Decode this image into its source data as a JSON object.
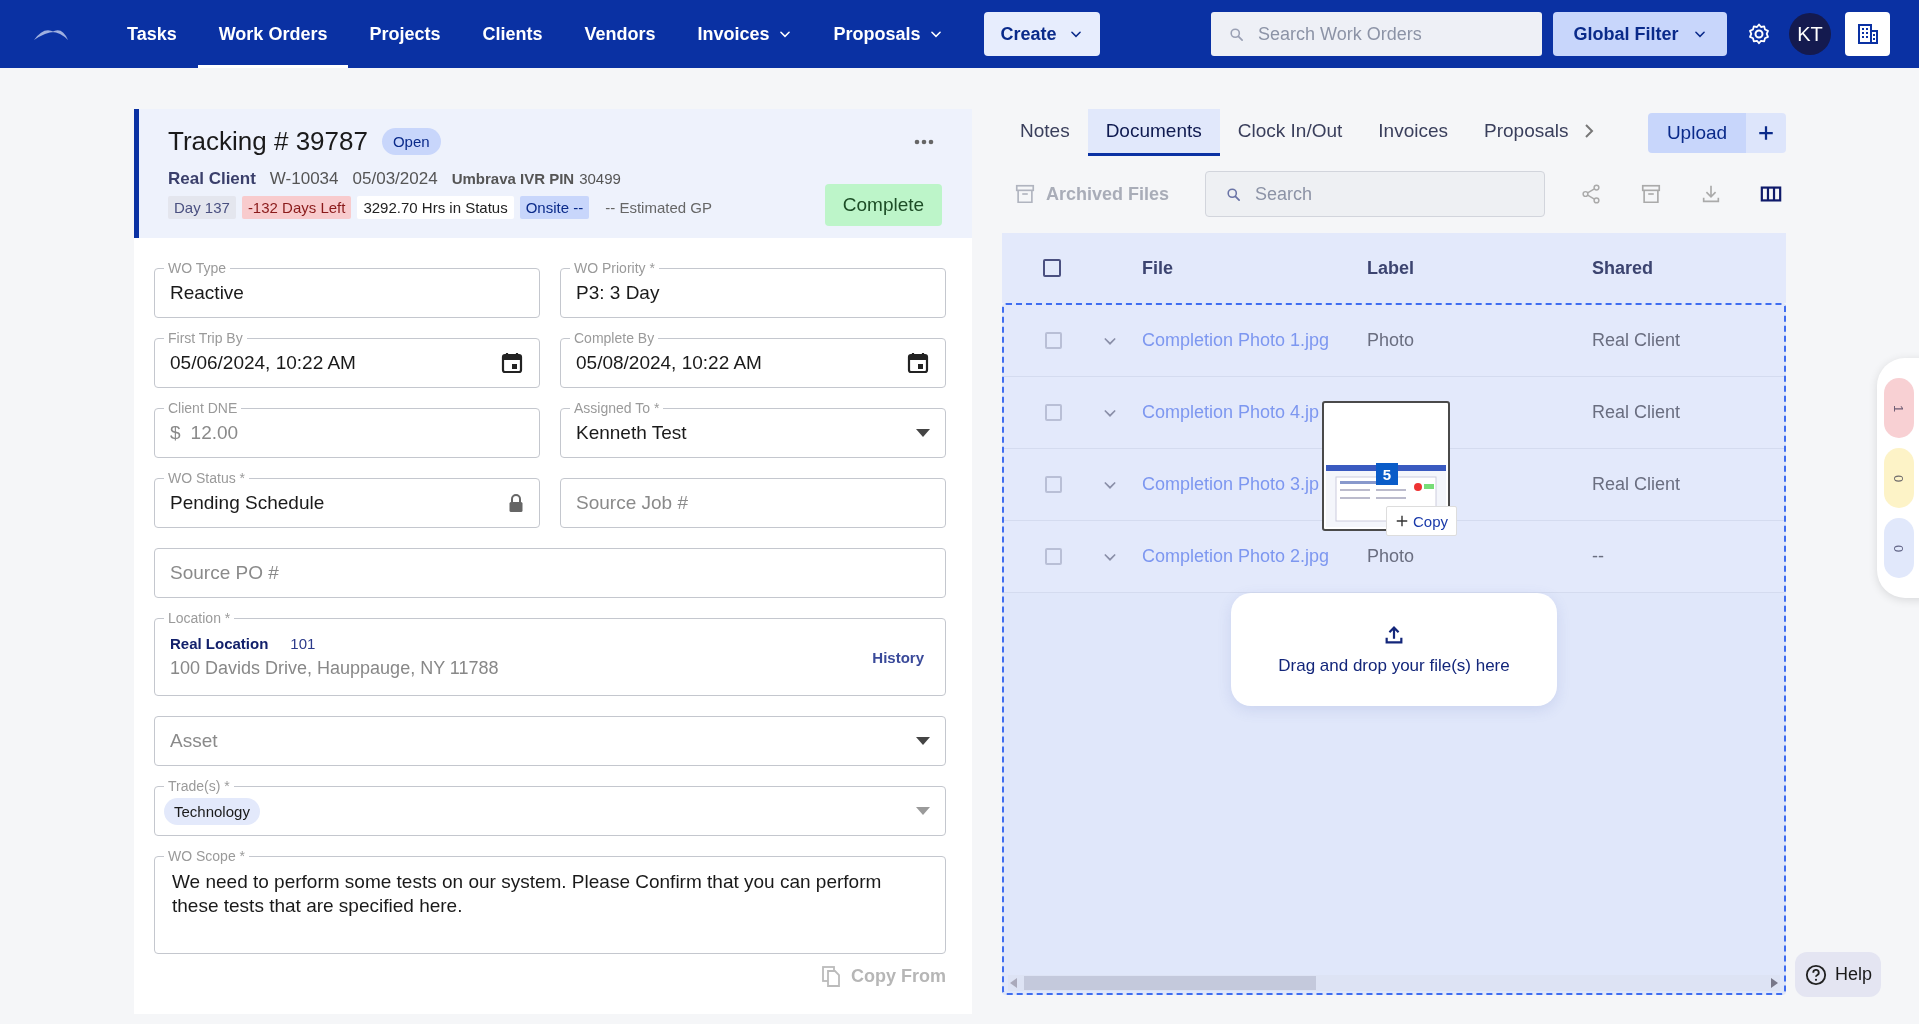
{
  "nav": {
    "items": [
      {
        "label": "Tasks",
        "selected": false,
        "dropdown": false
      },
      {
        "label": "Work Orders",
        "selected": true,
        "dropdown": false
      },
      {
        "label": "Projects",
        "selected": false,
        "dropdown": false
      },
      {
        "label": "Clients",
        "selected": false,
        "dropdown": false
      },
      {
        "label": "Vendors",
        "selected": false,
        "dropdown": false
      },
      {
        "label": "Invoices",
        "selected": false,
        "dropdown": true
      },
      {
        "label": "Proposals",
        "selected": false,
        "dropdown": true
      }
    ],
    "create_button": "Create",
    "search": {
      "placeholder": "Search Work Orders"
    },
    "filter_button": "Global Filter",
    "avatar": "KT"
  },
  "work_order": {
    "title": "Tracking # 39787",
    "status": "Open",
    "client": "Real Client",
    "number": "W-10034",
    "date": "05/03/2024",
    "pin_label": "Umbrava IVR PIN",
    "pin": "30499",
    "chips": [
      {
        "text": "Day 137",
        "kind": "muted"
      },
      {
        "text": "-132 Days Left",
        "kind": "danger"
      },
      {
        "text": "3292.70 Hrs in Status",
        "kind": "plain"
      },
      {
        "text": "Onsite --",
        "kind": "info"
      },
      {
        "text": "-- Estimated GP",
        "kind": "text"
      }
    ],
    "complete_button": "Complete"
  },
  "form": {
    "rows": [
      [
        {
          "kind": "text",
          "label": "WO Type",
          "value": "Reactive"
        },
        {
          "kind": "text",
          "label": "WO Priority *",
          "value": "P3: 3 Day"
        }
      ],
      [
        {
          "kind": "date",
          "label": "First Trip By",
          "value": "05/06/2024, 10:22 AM"
        },
        {
          "kind": "date",
          "label": "Complete By",
          "value": "05/08/2024, 10:22 AM"
        }
      ],
      [
        {
          "kind": "money",
          "label": "Client DNE",
          "prefix": "$",
          "placeholder": "12.00"
        },
        {
          "kind": "select",
          "label": "Assigned To *",
          "value": "Kenneth Test"
        }
      ],
      [
        {
          "kind": "locked",
          "label": "WO Status *",
          "value": "Pending Schedule"
        },
        {
          "kind": "text",
          "placeholder": "Source Job #"
        }
      ],
      [
        {
          "kind": "text",
          "placeholder": "Source PO #"
        }
      ],
      [
        {
          "kind": "location",
          "label": "Location *",
          "name": "Real Location",
          "code": "101",
          "address": "100 Davids Drive, Hauppauge, NY 11788",
          "link": "History"
        }
      ],
      [
        {
          "kind": "select",
          "placeholder": "Asset"
        }
      ],
      [
        {
          "kind": "tags",
          "label": "Trade(s) *",
          "tags": [
            "Technology"
          ]
        }
      ],
      [
        {
          "kind": "textarea",
          "label": "WO Scope *",
          "value": "We need to perform some tests on our system. Please Confirm that you can perform these tests that are specified here."
        }
      ]
    ],
    "copy_button": "Copy From"
  },
  "documents": {
    "tabs": [
      {
        "label": "Notes",
        "selected": false
      },
      {
        "label": "Documents",
        "selected": true
      },
      {
        "label": "Clock In/Out",
        "selected": false
      },
      {
        "label": "Invoices",
        "selected": false
      },
      {
        "label": "Proposals",
        "selected": false
      }
    ],
    "upload_button": "Upload",
    "toolbar": {
      "archived_button": "Archived Files",
      "search": {
        "placeholder": "Search"
      }
    },
    "table": {
      "columns": [
        "File",
        "Label",
        "Shared"
      ],
      "header_checked": false,
      "rows": [
        {
          "file": "Completion Photo 1.jpg",
          "label": "Photo",
          "shared": "Real Client",
          "checked": false
        },
        {
          "file": "Completion Photo 4.jp",
          "shared": "Real Client",
          "checked": false
        },
        {
          "file": "Completion Photo 3.jp",
          "shared": "Real Client",
          "checked": false
        },
        {
          "file": "Completion Photo 2.jpg",
          "label": "Photo",
          "shared": "--",
          "checked": false
        }
      ]
    },
    "drop_zone": {
      "text": "Drag and drop your file(s) here"
    },
    "drag_preview": {
      "count": "5",
      "action": "Copy"
    }
  },
  "side_counters": [
    {
      "count": "1",
      "color": "#f8d0d3"
    },
    {
      "count": "0",
      "color": "#fdf3c7"
    },
    {
      "count": "0",
      "color": "#e1e8fb"
    }
  ],
  "help_button": "Help"
}
